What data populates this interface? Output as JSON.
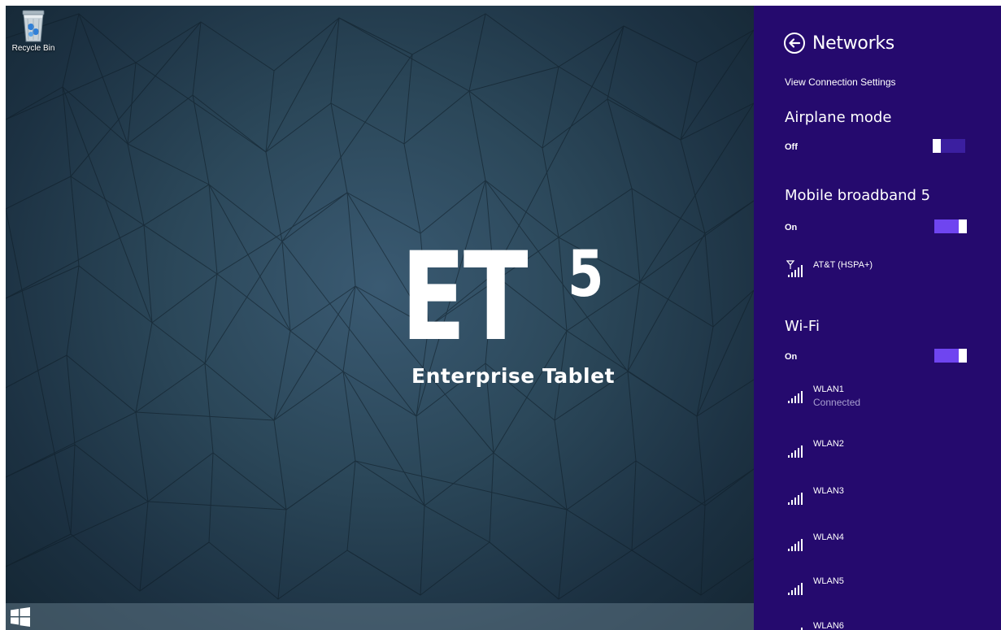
{
  "desktop": {
    "recycle_bin_label": "Recycle Bin",
    "brand_main": "ET",
    "brand_number": "5",
    "brand_subtitle": "Enterprise Tablet"
  },
  "networks_pane": {
    "title": "Networks",
    "view_settings_link": "View Connection Settings",
    "airplane_mode": {
      "title": "Airplane mode",
      "state": "Off"
    },
    "mobile_broadband": {
      "title": "Mobile broadband 5",
      "state": "On",
      "carrier": "AT&T (HSPA+)"
    },
    "wifi": {
      "title": "Wi-Fi",
      "state": "On",
      "networks": [
        {
          "name": "WLAN1",
          "status": "Connected"
        },
        {
          "name": "WLAN2"
        },
        {
          "name": "WLAN3"
        },
        {
          "name": "WLAN4"
        },
        {
          "name": "WLAN5"
        },
        {
          "name": "WLAN6"
        }
      ]
    }
  },
  "colors": {
    "pane_background": "#250a6e",
    "toggle_on": "#6f45f0",
    "toggle_off": "#3b1fa0"
  },
  "icons": {
    "back": "back-arrow-circle-icon",
    "signal": "signal-bars-icon",
    "mobile_signal": "antenna-signal-icon",
    "start": "windows-logo-icon",
    "recycle_bin": "recycle-bin-icon"
  }
}
